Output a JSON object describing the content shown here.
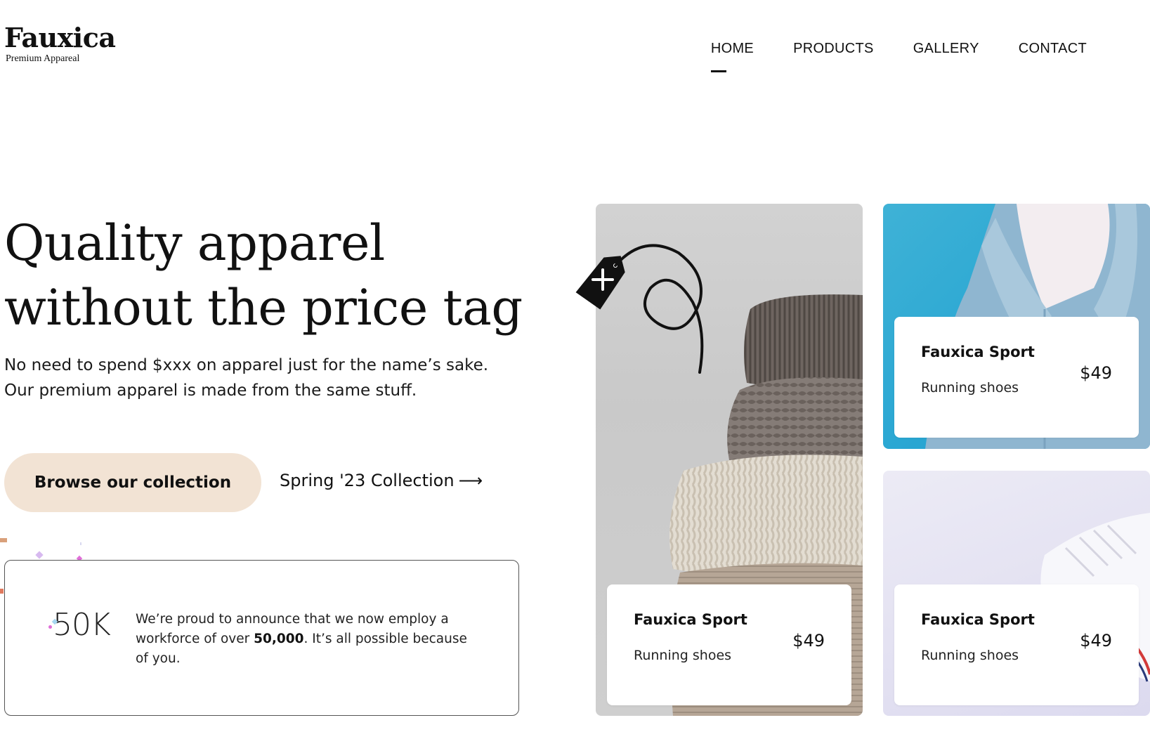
{
  "brand": {
    "name": "Fauxica",
    "tagline": "Premium Appareal"
  },
  "nav": {
    "items": [
      {
        "label": "HOME",
        "active": true
      },
      {
        "label": "PRODUCTS",
        "active": false
      },
      {
        "label": "GALLERY",
        "active": false
      },
      {
        "label": "CONTACT",
        "active": false
      }
    ]
  },
  "hero": {
    "title_line1": "Quality apparel",
    "title_line2": "without the price tag",
    "subtitle_line1": "No need to spend $xxx on apparel just for the name’s sake.",
    "subtitle_line2": "Our premium apparel is made from the same stuff.",
    "cta_label": "Browse our collection",
    "cta_color": "#f2e3d4",
    "link_label": "Spring '23 Collection",
    "link_arrow": "⟶"
  },
  "stats": {
    "number": "50K",
    "text_before": "We’re proud to announce that we now employ a workforce of over ",
    "text_bold": "50,000",
    "text_after": ". It’s all possible because of you."
  },
  "products": [
    {
      "name": "Fauxica Sport",
      "subtitle": "Running shoes",
      "price": "$49",
      "image": "folded-sweaters"
    },
    {
      "name": "Fauxica Sport",
      "subtitle": "Running shoes",
      "price": "$49",
      "image": "denim-jacket"
    },
    {
      "name": "Fauxica Sport",
      "subtitle": "Running shoes",
      "price": "$49",
      "image": "white-sneaker"
    }
  ],
  "icons": {
    "price_tag": "price-tag-plus-icon"
  }
}
